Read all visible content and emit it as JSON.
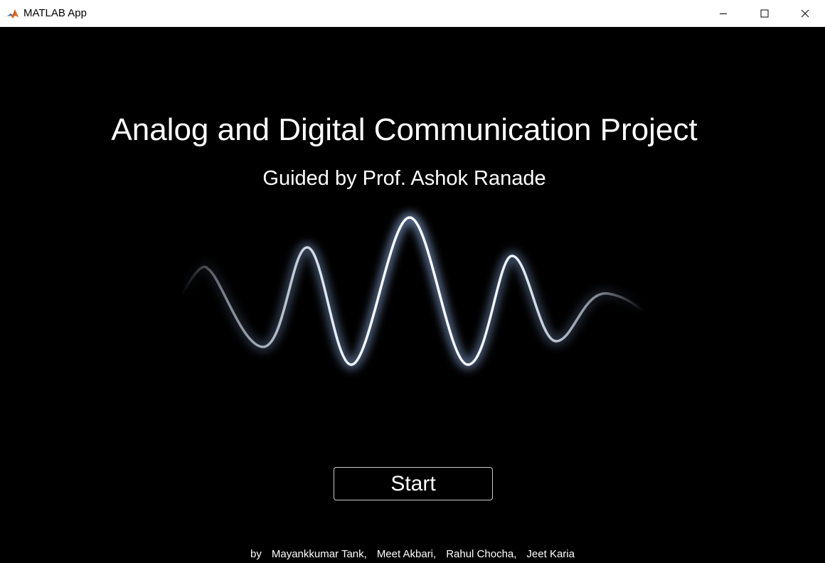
{
  "window": {
    "title": "MATLAB App",
    "icon": "matlab-logo-icon",
    "controls": [
      "minimize-icon",
      "maximize-icon",
      "close-icon"
    ]
  },
  "main": {
    "title": "Analog and Digital Communication Project",
    "subtitle": "Guided by Prof. Ashok Ranade",
    "graphic": "signal-wave-icon",
    "start_label": "Start"
  },
  "credits": {
    "prefix": "by",
    "authors": [
      "Mayankkumar Tank,",
      "Meet Akbari,",
      "Rahul Chocha,",
      "Jeet Karia"
    ]
  },
  "colors": {
    "background": "#000000",
    "text": "#ffffff",
    "wave_glow": "#9fc3ff"
  }
}
